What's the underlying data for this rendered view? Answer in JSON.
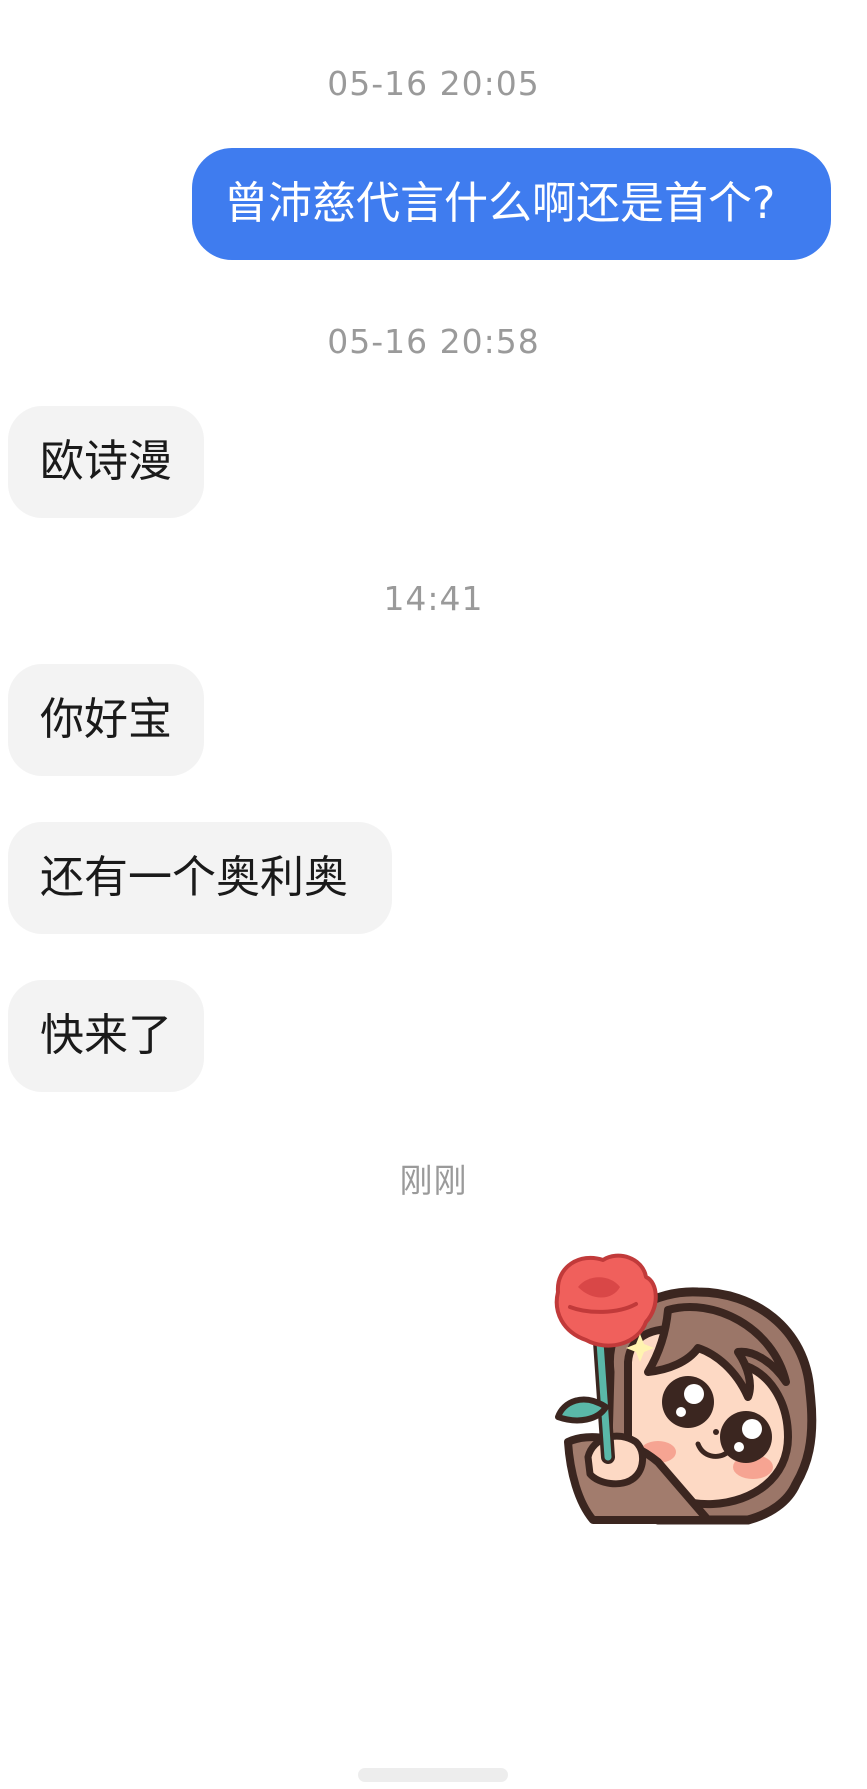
{
  "messages": [
    {
      "kind": "timestamp",
      "text": "05-16 20:05"
    },
    {
      "kind": "outgoing",
      "text": "曾沛慈代言什么啊还是首个?"
    },
    {
      "kind": "timestamp",
      "text": "05-16 20:58"
    },
    {
      "kind": "incoming",
      "text": "欧诗漫"
    },
    {
      "kind": "timestamp",
      "text": "14:41"
    },
    {
      "kind": "incoming",
      "text": "你好宝"
    },
    {
      "kind": "incoming",
      "text": "还有一个奥利奥"
    },
    {
      "kind": "incoming",
      "text": "快来了"
    },
    {
      "kind": "timestamp",
      "text": "刚刚"
    },
    {
      "kind": "sticker",
      "icon": "girl-holding-rose-sticker"
    }
  ],
  "colors": {
    "outgoing_bubble": "#3f7cef",
    "incoming_bubble": "#f3f3f3",
    "timestamp_text": "#9a9a9a"
  }
}
